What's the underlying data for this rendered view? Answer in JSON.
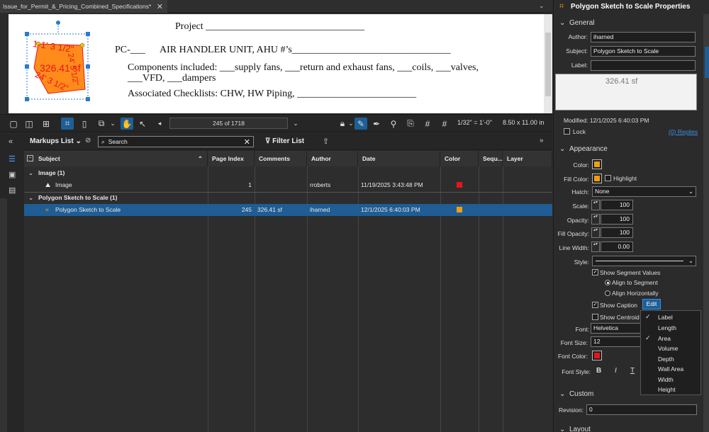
{
  "tab": {
    "title": "Issue_for_Permit_&_Pricing_Combined_Specifications*",
    "close": "✕",
    "dropdown": "⌄"
  },
  "document": {
    "project_line": "Project ________________________________",
    "pc_prefix": "PC-___",
    "ahu_line": "AIR HANDLER UNIT, AHU #’s________________________________",
    "components_line1": "Components included: ___supply fans, ___return and exhaust fans, ___coils, ___valves,",
    "components_line2": "___VFD, ___dampers",
    "checklists_line": "Associated Checklists:  CHW, HW Piping, ________________________",
    "markup_area": "326.41 sf",
    "markup_seg_top": "1-1' 3 1/2\"",
    "markup_seg_side": "24' 5 1/2\"",
    "markup_seg_bottom": "24' 3 1/2\"",
    "markup_fill": "#ff8c1a",
    "markup_text_color": "#e8141c"
  },
  "toolbar": {
    "page_field": "245 of 1718",
    "scale": "1/32\" = 1'-0\"",
    "size": "8.50 x 11.00 in"
  },
  "markups": {
    "title": "Markups List",
    "search_placeholder": "Search",
    "filter_label": "Filter List",
    "columns": [
      "Subject",
      "Page Index",
      "Comments",
      "Author",
      "Date",
      "Color",
      "Sequ...",
      "Layer"
    ],
    "groups": [
      {
        "label": "Image (1)",
        "items": [
          {
            "subject": "Image",
            "page": "1",
            "comments": "",
            "author": "rroberts",
            "date": "11/19/2025 3:43:48 PM",
            "color": "#e8141c"
          }
        ]
      },
      {
        "label": "Polygon Sketch to Scale (1)",
        "items": [
          {
            "subject": "Polygon Sketch to Scale",
            "page": "245",
            "comments": "326.41 sf",
            "author": "iharned",
            "date": "12/1/2025 6:40:03 PM",
            "color": "#f39c12"
          }
        ]
      }
    ]
  },
  "properties": {
    "title": "Polygon Sketch to Scale Properties",
    "general": "General",
    "author_label": "Author:",
    "author": "iharned",
    "subject_label": "Subject:",
    "subject": "Polygon Sketch to Scale",
    "label_label": "Label:",
    "label": "",
    "caption_value": "326.41 sf",
    "modified": "Modified: 12/1/2025 6:40:03 PM",
    "lock": "Lock",
    "replies": "(0) Replies",
    "appearance": "Appearance",
    "color_label": "Color:",
    "fill_color_label": "Fill Color:",
    "highlight": "Highlight",
    "hatch_label": "Hatch:",
    "hatch": "None",
    "scale_label": "Scale:",
    "scale": "100",
    "opacity_label": "Opacity:",
    "opacity": "100",
    "fill_opacity_label": "Fill Opacity:",
    "fill_opacity": "100",
    "line_width_label": "Line Width:",
    "line_width": "0.00",
    "style_label": "Style:",
    "show_segment_values": "Show Segment Values",
    "align_to_segment": "Align to Segment",
    "align_horizontally": "Align Horizontally",
    "show_caption": "Show Caption",
    "edit": "Edit",
    "show_centroid": "Show Centroid",
    "font_label": "Font:",
    "font": "Helvetica",
    "font_size_label": "Font Size:",
    "font_size": "12",
    "font_color_label": "Font Color:",
    "font_style_label": "Font Style:",
    "bold": "B",
    "italic": "I",
    "underline": "T",
    "custom": "Custom",
    "revision_label": "Revision:",
    "revision": "0",
    "layout": "Layout",
    "color": "#f39c12",
    "font_color": "#e8141c"
  },
  "caption_menu": [
    {
      "label": "Label",
      "checked": true
    },
    {
      "label": "Length",
      "checked": false
    },
    {
      "label": "Area",
      "checked": true
    },
    {
      "label": "Volume",
      "checked": false
    },
    {
      "label": "Depth",
      "checked": false
    },
    {
      "label": "Wall Area",
      "checked": false
    },
    {
      "label": "Width",
      "checked": false
    },
    {
      "label": "Height",
      "checked": false
    }
  ]
}
